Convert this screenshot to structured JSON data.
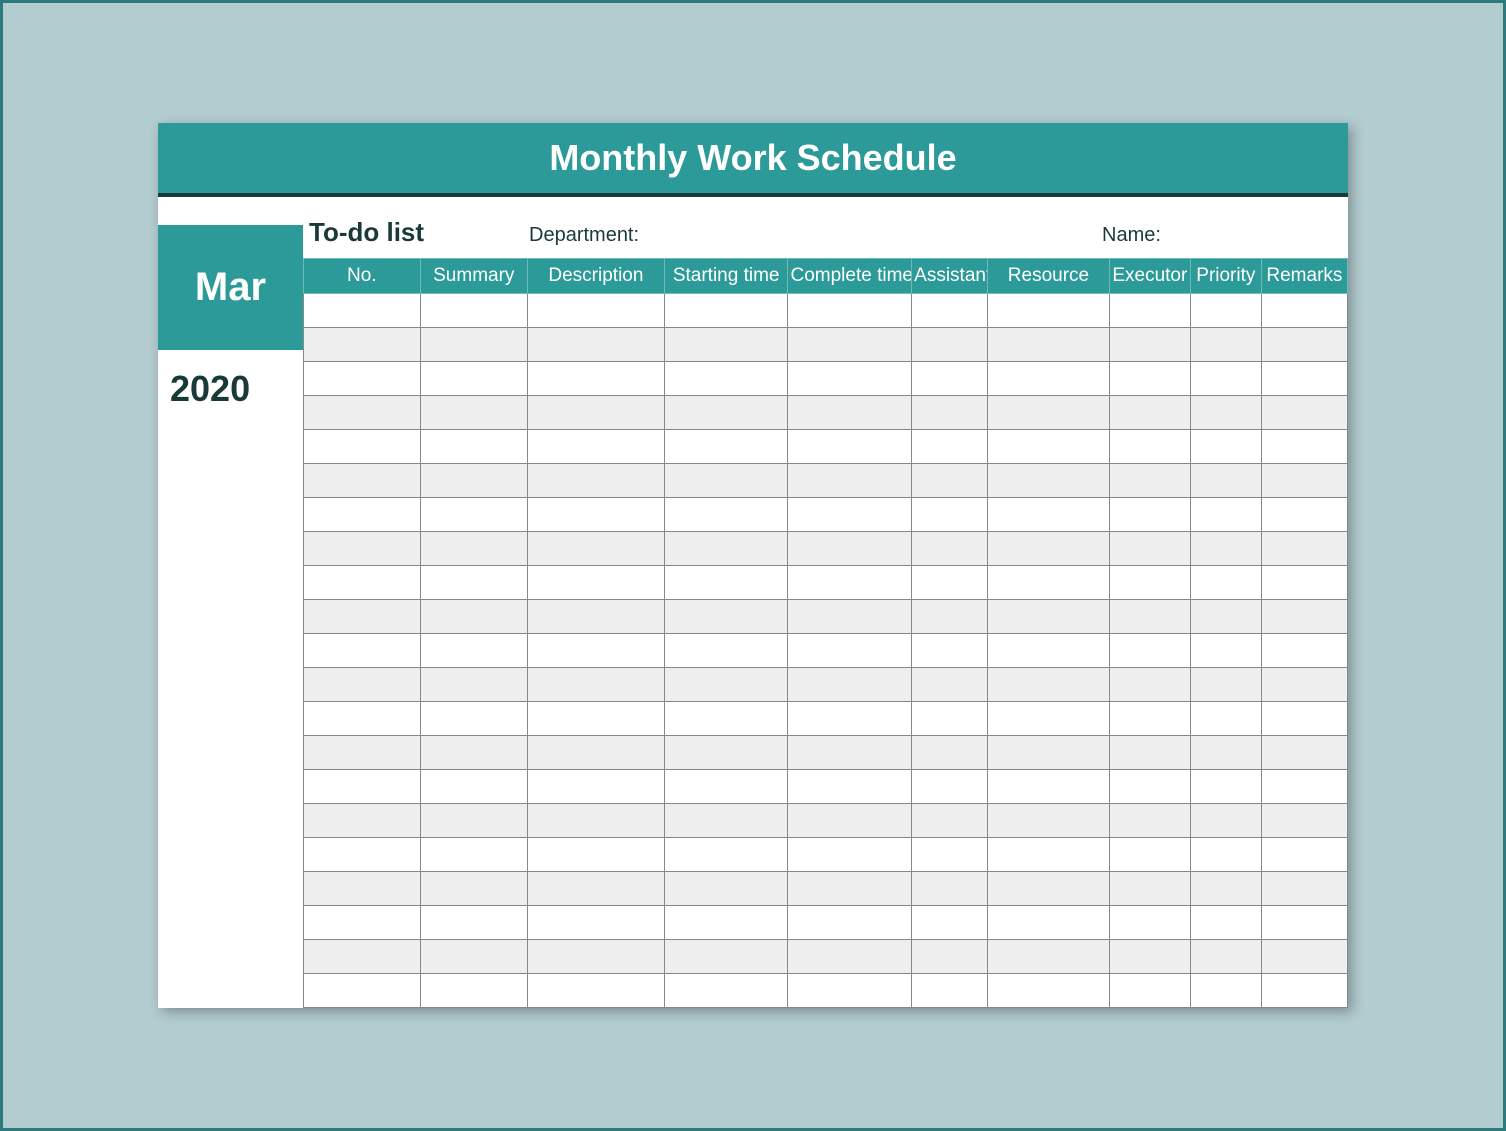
{
  "title": "Monthly Work Schedule",
  "side": {
    "month": "Mar",
    "year": "2020"
  },
  "meta": {
    "todo_label": "To-do list",
    "department_label": "Department:",
    "name_label": "Name:"
  },
  "table": {
    "headers": [
      "No.",
      "Summary",
      "Description",
      "Starting time",
      "Complete time",
      "Assistant",
      "Resource",
      "Executor",
      "Priority",
      "Remarks"
    ],
    "row_count": 21
  },
  "colors": {
    "accent": "#2d9a9a",
    "background": "#b3ccd0",
    "alt_row": "#eeeeee"
  }
}
